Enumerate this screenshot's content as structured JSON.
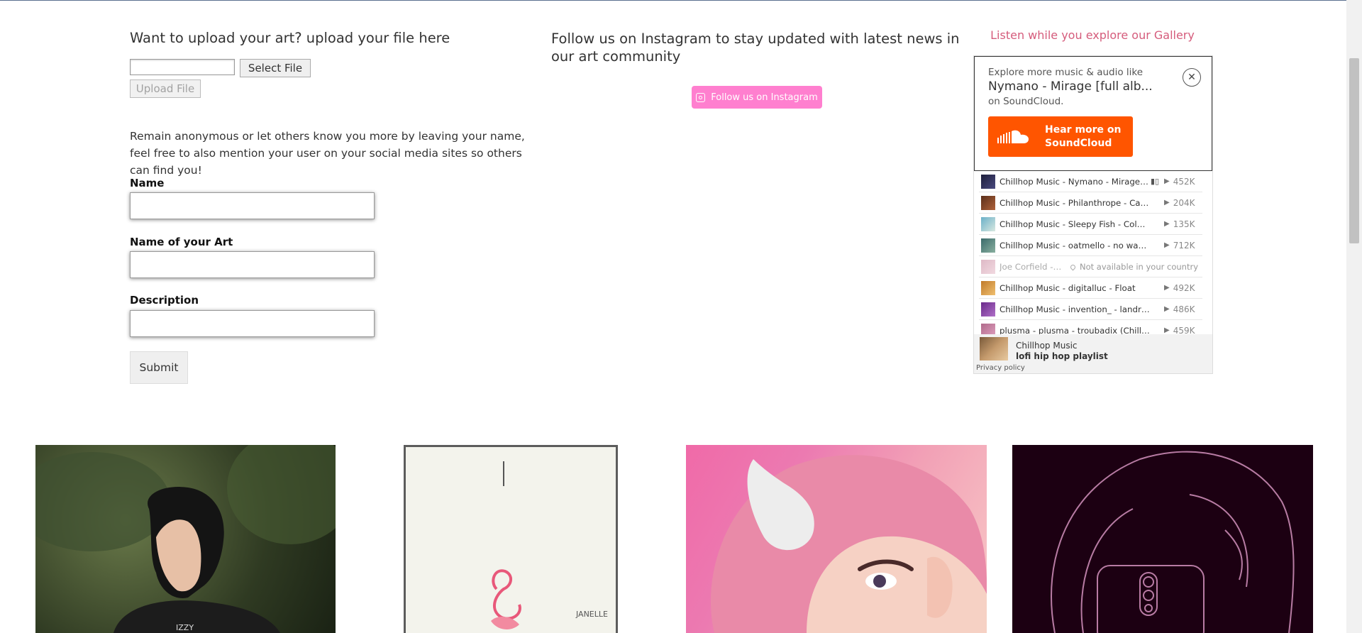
{
  "upload": {
    "title": "Want to upload your art? upload your file here",
    "file_value": "",
    "select_file_label": "Select File",
    "upload_file_label": "Upload File"
  },
  "intro_text": "Remain anonymous or let others know you more by leaving your name, feel free to also mention your user on your social media sites so others can find you!",
  "form": {
    "name_label": "Name",
    "name_value": "",
    "art_name_label": "Name of your Art",
    "art_name_value": "",
    "description_label": "Description",
    "description_value": "",
    "submit_label": "Submit"
  },
  "instagram": {
    "title": "Follow us on Instagram to stay updated with latest news in our art community",
    "button_label": "Follow us on Instagram",
    "button_color": "#ff7fcf",
    "icon": "instagram-icon"
  },
  "soundcloud": {
    "heading": "Listen while you explore our Gallery",
    "heading_color": "#d55c7c",
    "explore_text": "Explore more music & audio like",
    "track_title": "Nymano - Mirage [full alb...",
    "on_soundcloud": "on SoundCloud.",
    "hear_more_label": "Hear more on SoundCloud",
    "brand_color": "#ff5500",
    "tracks": [
      {
        "title": "Chillhop Music - Nymano - Mirage [...",
        "plays": "452K",
        "playing": true
      },
      {
        "title": "Chillhop Music - Philanthrope - Cabin ...",
        "plays": "204K"
      },
      {
        "title": "Chillhop Music - Sleepy Fish - Colors F...",
        "plays": "135K"
      },
      {
        "title": "Chillhop Music - oatmello - no way ba...",
        "plays": "712K"
      },
      {
        "title": "Joe Corfield - ...",
        "unavailable": "Not available in your country"
      },
      {
        "title": "Chillhop Music - digitalluc - Float",
        "plays": "492K"
      },
      {
        "title": "Chillhop Music - invention_ - landrace",
        "plays": "486K"
      },
      {
        "title": "plusma - plusma - troubadix (Chillhop...",
        "plays": "459K"
      }
    ],
    "footer_user": "Chillhop Music",
    "footer_playlist": "lofi hip hop playlist",
    "privacy": "Privacy policy"
  },
  "gallery": {
    "captions": [
      "IZZY",
      "JANELLE"
    ]
  }
}
